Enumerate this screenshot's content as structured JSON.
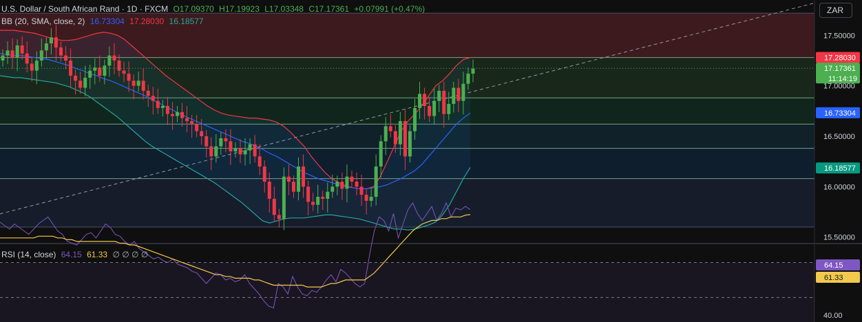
{
  "header": {
    "symbol_title": "U.S. Dollar / South African Rand · 1D · FXCM",
    "open": "O17.09370",
    "high": "H17.19923",
    "low": "L17.03348",
    "close": "C17.17361",
    "change": "+0.07991 (+0.47%)"
  },
  "bb_legend": {
    "name": "BB (20, SMA, close, 2)",
    "basis": "16.73304",
    "upper": "17.28030",
    "lower": "16.18577"
  },
  "rsi_legend": {
    "name": "RSI (14, close)",
    "rsi": "64.15",
    "ma": "61.33",
    "na": "∅ ∅ ∅ ∅"
  },
  "currency_button": "ZAR",
  "colors": {
    "up": "#4caf50",
    "down": "#f23645",
    "bb_basis": "#2962ff",
    "bb_upper": "#f23645",
    "bb_lower": "#26a69a",
    "rsi": "#7e57c2",
    "rsi_ma": "#f2c94c"
  },
  "chart_data": [
    {
      "type": "candlestick",
      "y_ticks": [
        "17.50000",
        "17.00000",
        "16.50000",
        "16.00000",
        "15.50000"
      ],
      "ylim": [
        15.45,
        17.85
      ],
      "last_price": "17.17361",
      "countdown": "11:14:19",
      "bb_upper_label": "17.28030",
      "bb_basis_label": "16.73304",
      "bb_lower_label": "16.18577",
      "zones": [
        {
          "from": 17.28,
          "to": 17.72,
          "color": "#3c1a1e"
        },
        {
          "from": 16.88,
          "to": 17.28,
          "color": "#18271a"
        },
        {
          "from": 16.62,
          "to": 16.88,
          "color": "#10261c"
        },
        {
          "from": 16.38,
          "to": 16.62,
          "color": "#10212a"
        },
        {
          "from": 16.08,
          "to": 16.38,
          "color": "#0f1e2c"
        },
        {
          "from": 15.6,
          "to": 16.08,
          "color": "#161c2a"
        }
      ],
      "levels": [
        17.72,
        17.28,
        16.88,
        16.62,
        16.38,
        16.08,
        15.6
      ],
      "closes": [
        17.3,
        17.35,
        17.28,
        17.4,
        17.32,
        17.22,
        17.15,
        17.25,
        17.35,
        17.42,
        17.48,
        17.38,
        17.3,
        17.25,
        17.1,
        17.05,
        16.98,
        17.08,
        17.15,
        17.18,
        17.1,
        17.2,
        17.3,
        17.25,
        17.15,
        17.12,
        17.05,
        17.0,
        17.05,
        16.95,
        16.9,
        16.85,
        16.78,
        16.8,
        16.72,
        16.7,
        16.74,
        16.68,
        16.65,
        16.62,
        16.55,
        16.5,
        16.4,
        16.3,
        16.4,
        16.48,
        16.45,
        16.35,
        16.38,
        16.32,
        16.36,
        16.42,
        16.3,
        16.2,
        16.05,
        15.88,
        15.72,
        15.68,
        16.1,
        16.05,
        15.95,
        16.2,
        16.0,
        15.85,
        15.82,
        15.9,
        15.88,
        15.95,
        16.0,
        16.05,
        15.98,
        16.1,
        16.05,
        16.0,
        15.92,
        15.86,
        15.9,
        16.2,
        16.45,
        16.6,
        16.55,
        16.42,
        16.65,
        16.3,
        16.55,
        16.78,
        16.92,
        16.8,
        16.7,
        16.85,
        16.95,
        16.72,
        16.82,
        16.98,
        16.85,
        17.02,
        17.12,
        17.17
      ],
      "bb_upper": [
        17.55,
        17.55,
        17.55,
        17.54,
        17.53,
        17.52,
        17.5,
        17.48,
        17.46,
        17.45,
        17.45,
        17.46,
        17.48,
        17.5,
        17.52,
        17.53,
        17.52,
        17.5,
        17.46,
        17.4,
        17.34,
        17.28,
        17.22,
        17.16,
        17.1,
        17.05,
        17.0,
        16.95,
        16.9,
        16.85,
        16.8,
        16.76,
        16.73,
        16.71,
        16.7,
        16.69,
        16.68,
        16.68,
        16.67,
        16.66,
        16.64,
        16.6,
        16.54,
        16.47,
        16.4,
        16.3,
        16.22,
        16.14,
        16.08,
        16.04,
        16.01,
        15.99,
        15.98,
        15.98,
        16.0,
        16.1,
        16.25,
        16.4,
        16.55,
        16.65,
        16.72,
        16.8,
        16.9,
        17.0,
        17.05,
        17.12,
        17.2,
        17.26,
        17.28
      ],
      "bb_basis": [
        17.32,
        17.31,
        17.3,
        17.3,
        17.29,
        17.28,
        17.27,
        17.26,
        17.24,
        17.22,
        17.2,
        17.17,
        17.15,
        17.12,
        17.1,
        17.07,
        17.05,
        17.02,
        16.99,
        16.96,
        16.93,
        16.9,
        16.86,
        16.83,
        16.79,
        16.76,
        16.72,
        16.69,
        16.66,
        16.63,
        16.6,
        16.57,
        16.54,
        16.51,
        16.48,
        16.45,
        16.43,
        16.4,
        16.37,
        16.33,
        16.3,
        16.26,
        16.22,
        16.18,
        16.14,
        16.11,
        16.08,
        16.06,
        16.04,
        16.02,
        16.0,
        15.99,
        15.98,
        15.98,
        15.99,
        16.0,
        16.02,
        16.05,
        16.08,
        16.12,
        16.16,
        16.22,
        16.3,
        16.38,
        16.46,
        16.54,
        16.62,
        16.68,
        16.73
      ],
      "bb_lower": [
        17.1,
        17.09,
        17.08,
        17.08,
        17.07,
        17.06,
        17.05,
        17.04,
        17.03,
        17.01,
        16.99,
        16.96,
        16.93,
        16.89,
        16.84,
        16.79,
        16.74,
        16.69,
        16.63,
        16.57,
        16.51,
        16.45,
        16.4,
        16.36,
        16.32,
        16.28,
        16.24,
        16.2,
        16.16,
        16.12,
        16.08,
        16.04,
        15.99,
        15.94,
        15.89,
        15.84,
        15.78,
        15.72,
        15.66,
        15.64,
        15.66,
        15.68,
        15.69,
        15.69,
        15.69,
        15.7,
        15.71,
        15.72,
        15.72,
        15.71,
        15.7,
        15.69,
        15.68,
        15.66,
        15.64,
        15.62,
        15.6,
        15.58,
        15.58,
        15.57,
        15.58,
        15.6,
        15.62,
        15.65,
        15.72,
        15.82,
        15.95,
        16.08,
        16.19
      ]
    },
    {
      "type": "line",
      "title": "RSI (14, close)",
      "ylim": [
        36,
        80
      ],
      "y_ticks": [
        "40.00"
      ],
      "rsi_label": "64.15",
      "ma_label": "61.33",
      "rsi": [
        57,
        55,
        53,
        56,
        54,
        52,
        50,
        53,
        56,
        58,
        60,
        56,
        52,
        50,
        46,
        45,
        44,
        47,
        50,
        51,
        48,
        52,
        56,
        54,
        50,
        49,
        46,
        44,
        46,
        42,
        40,
        38,
        36,
        37,
        35,
        34,
        36,
        33,
        32,
        31,
        29,
        28,
        25,
        22,
        25,
        28,
        27,
        24,
        25,
        23,
        24,
        27,
        22,
        19,
        16,
        12,
        9,
        8,
        22,
        20,
        16,
        26,
        20,
        16,
        15,
        18,
        17,
        20,
        24,
        27,
        23,
        30,
        28,
        25,
        22,
        20,
        22,
        38,
        52,
        60,
        58,
        52,
        62,
        48,
        56,
        64,
        68,
        62,
        58,
        62,
        66,
        58,
        62,
        68,
        60,
        65,
        64,
        66,
        64.15
      ],
      "ma": [
        48,
        48,
        48,
        48,
        48,
        48,
        48,
        48,
        49,
        49,
        49,
        49,
        48,
        48,
        47,
        47,
        46,
        46,
        46,
        46,
        46,
        46,
        46,
        46,
        46,
        45,
        45,
        44,
        44,
        43,
        42,
        41,
        40,
        39,
        38,
        37,
        36,
        35,
        34,
        33,
        32,
        31,
        30,
        29,
        28,
        27,
        27,
        26,
        26,
        25,
        25,
        25,
        25,
        24,
        24,
        23,
        22,
        21,
        21,
        21,
        21,
        21,
        21,
        21,
        20,
        20,
        20,
        20,
        21,
        22,
        22,
        23,
        24,
        24,
        24,
        24,
        24,
        26,
        28,
        31,
        34,
        37,
        40,
        43,
        46,
        49,
        52,
        54,
        56,
        57,
        58,
        58,
        59,
        59,
        60,
        60,
        60,
        61,
        61.33
      ]
    }
  ]
}
